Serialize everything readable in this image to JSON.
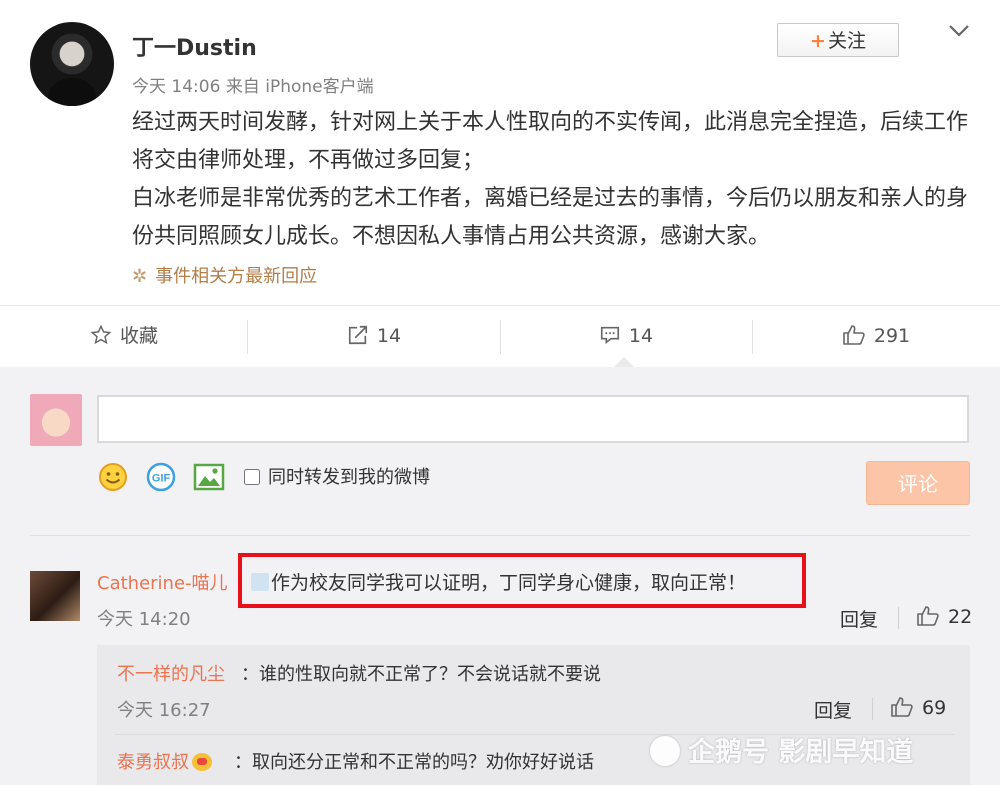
{
  "post": {
    "author": "丁一Dustin",
    "time": "今天 14:06",
    "source": "来自 iPhone客户端",
    "follow_label": "关注",
    "content": [
      "经过两天时间发酵，针对网上关于本人性取向的不实传闻，此消息完全捏造，后续工作将交由律师处理，不再做过多回复；",
      "白冰老师是非常优秀的艺术工作者，离婚已经是过去的事情，今后仍以朋友和亲人的身份共同照顾女儿成长。不想因私人事情占用公共资源，感谢大家。"
    ],
    "topic": "事件相关方最新回应"
  },
  "actions": {
    "favorite": "收藏",
    "repost": "14",
    "comment": "14",
    "like": "291"
  },
  "composer": {
    "placeholder": "",
    "sync_label": "同时转发到我的微博",
    "submit_label": "评论",
    "gif_label": "GIF"
  },
  "comments": [
    {
      "user": "Catherine-喵儿",
      "text": "作为校友同学我可以证明，丁同学身心健康，取向正常！",
      "time": "今天 14:20",
      "reply_label": "回复",
      "likes": "22",
      "replies": [
        {
          "user": "不一样的凡尘",
          "text": "：谁的性取向就不正常了？不会说话就不要说",
          "time": "今天 16:27",
          "reply_label": "回复",
          "likes": "69"
        },
        {
          "user": "泰勇叔叔",
          "text": "：取向还分正常和不正常的吗？劝你好好说话"
        }
      ]
    }
  ],
  "watermark": "企鹅号 影剧早知道",
  "colors": {
    "accent": "#ff8140",
    "username": "#eb7350",
    "highlight_box": "#e8101a",
    "submit_disabled": "#fdc5a7"
  }
}
